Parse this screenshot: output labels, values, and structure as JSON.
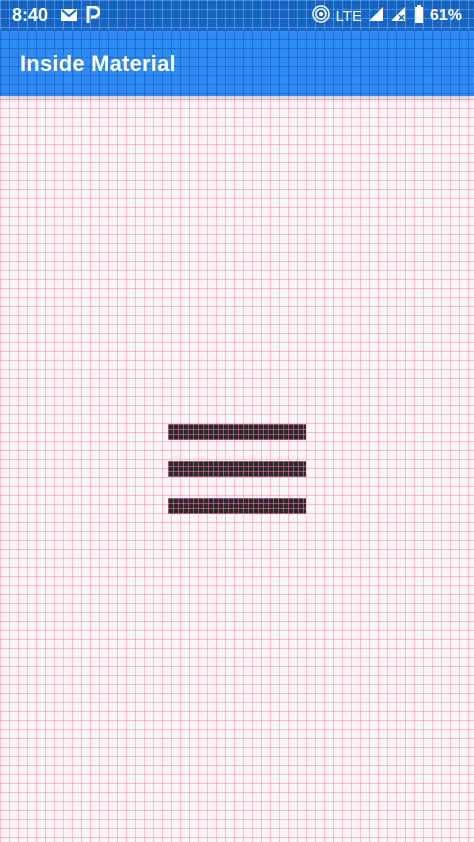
{
  "status_bar": {
    "time": "8:40",
    "notification_icons": [
      "gmail-icon",
      "parking-p-icon"
    ],
    "network_label": "LTE",
    "battery_text": "61%",
    "icons": [
      "hotspot-icon",
      "signal-icon",
      "no-signal-icon",
      "battery-icon"
    ]
  },
  "app_bar": {
    "title": "Inside Material"
  },
  "content": {
    "icon": "menu-icon"
  },
  "colors": {
    "status_bar": "#1565c0",
    "app_bar": "#2f8cf0",
    "background": "#fdf6f9",
    "grid_lines": "#ec78aa",
    "menu_icon": "#2a2a2a"
  }
}
